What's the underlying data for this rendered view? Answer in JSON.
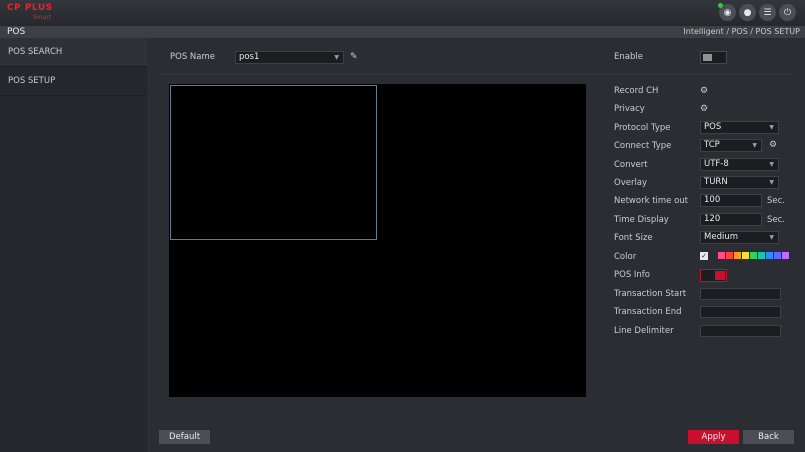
{
  "header": {
    "logo_text": "CP PLUS",
    "logo_sub": "Smart",
    "icons": [
      "eye-icon",
      "user-icon",
      "menu-icon",
      "power-icon"
    ],
    "status_color": "#2fcc3e"
  },
  "titlebar": {
    "title": "POS",
    "breadcrumb": "Intelligent  /  POS  /  POS SETUP"
  },
  "sidebar": {
    "items": [
      {
        "label": "POS SEARCH"
      },
      {
        "label": "POS SETUP"
      }
    ]
  },
  "main": {
    "pos_name_label": "POS Name",
    "pos_name_value": "pos1",
    "enable_label": "Enable",
    "enable_on": false,
    "fields": {
      "record_ch": "Record CH",
      "privacy": "Privacy",
      "protocol_type": {
        "label": "Protocol Type",
        "value": "POS"
      },
      "connect_type": {
        "label": "Connect Type",
        "value": "TCP"
      },
      "convert": {
        "label": "Convert",
        "value": "UTF-8"
      },
      "overlay": {
        "label": "Overlay",
        "value": "TURN"
      },
      "network_timeout": {
        "label": "Network time out",
        "value": "100",
        "unit": "Sec."
      },
      "time_display": {
        "label": "Time Display",
        "value": "120",
        "unit": "Sec."
      },
      "font_size": {
        "label": "Font Size",
        "value": "Medium"
      },
      "color": {
        "label": "Color",
        "swatches": [
          "#ff4d88",
          "#ff4040",
          "#ff9a1f",
          "#ffe22e",
          "#33d15a",
          "#1fc4a8",
          "#2f8cff",
          "#5b6bff",
          "#c46bff"
        ]
      },
      "pos_info": {
        "label": "POS Info",
        "on": true
      },
      "transaction_start": {
        "label": "Transaction Start",
        "value": ""
      },
      "transaction_end": {
        "label": "Transaction End",
        "value": ""
      },
      "line_delimiter": {
        "label": "Line Delimiter",
        "value": ""
      }
    }
  },
  "footer": {
    "default_label": "Default",
    "apply_label": "Apply",
    "back_label": "Back"
  },
  "colors": {
    "accent": "#c8102e",
    "background": "#2a2d31"
  }
}
